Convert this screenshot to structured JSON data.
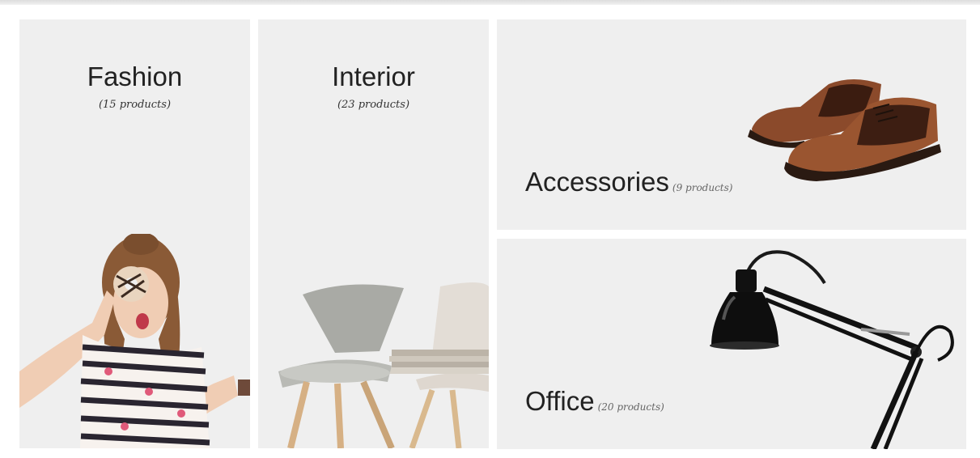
{
  "categories": {
    "fashion": {
      "title": "Fashion",
      "count": "(15 products)"
    },
    "interior": {
      "title": "Interior",
      "count": "(23 products)"
    },
    "accessories": {
      "title": "Accessories",
      "count": "(9 products)"
    },
    "office": {
      "title": "Office",
      "count": "(20 products)"
    }
  },
  "colors": {
    "tile_bg": "#efefef",
    "text": "#222222",
    "count_text": "#666666"
  }
}
